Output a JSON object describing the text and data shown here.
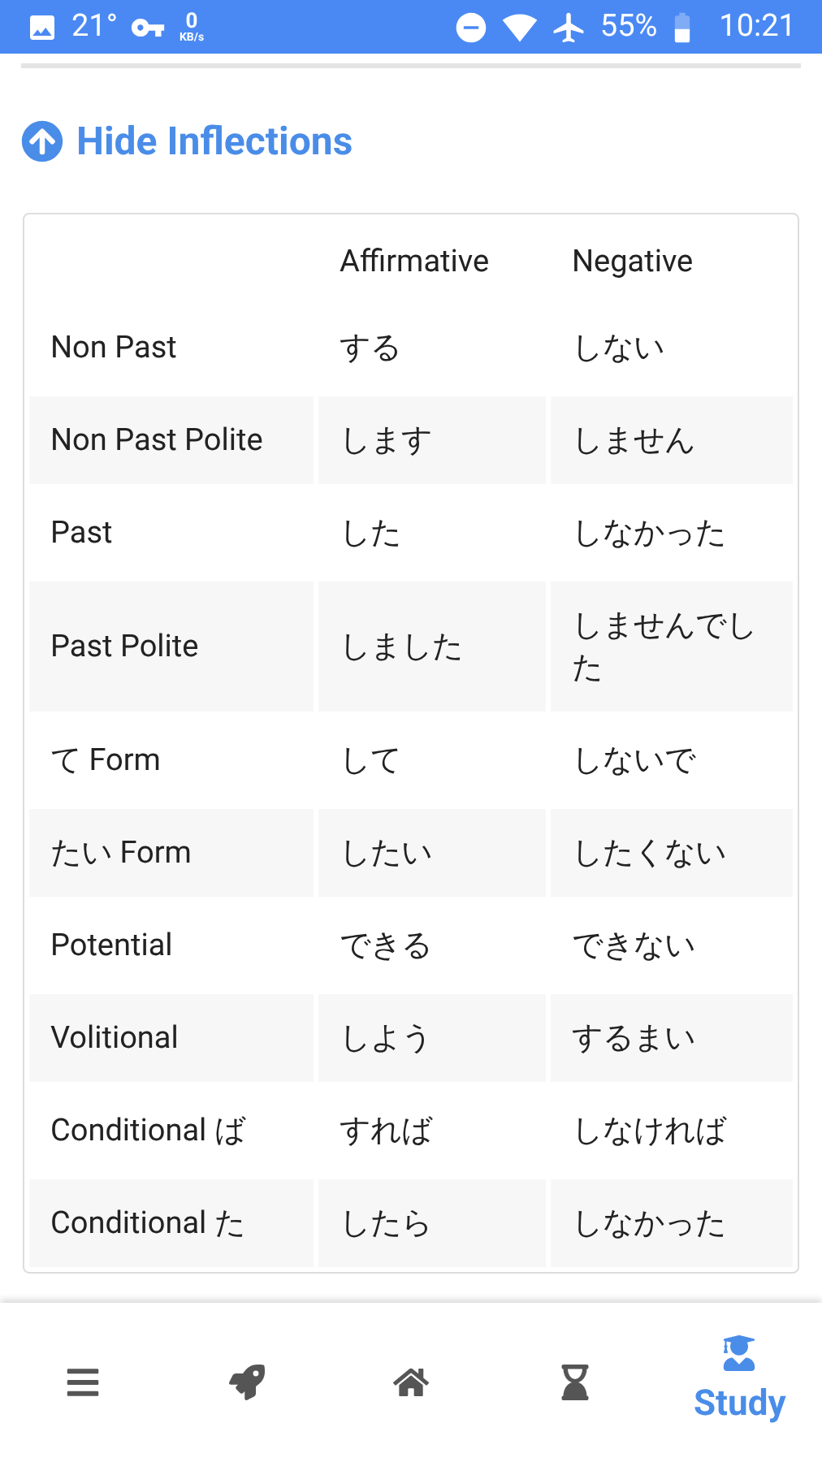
{
  "status_bar": {
    "temperature": "21°",
    "speed_value": "0",
    "speed_unit": "KB/s",
    "battery": "55%",
    "time": "10:21"
  },
  "toggle": {
    "label": "Hide Inflections",
    "expanded": true
  },
  "table": {
    "columns": [
      "Affirmative",
      "Negative"
    ],
    "rows": [
      {
        "form": "Non Past",
        "affirmative": "する",
        "negative": "しない"
      },
      {
        "form": "Non Past Polite",
        "affirmative": "します",
        "negative": "しません"
      },
      {
        "form": "Past",
        "affirmative": "した",
        "negative": "しなかった"
      },
      {
        "form": "Past Polite",
        "affirmative": "しました",
        "negative": "しませんでした"
      },
      {
        "form": "て Form",
        "affirmative": "して",
        "negative": "しないで"
      },
      {
        "form": "たい Form",
        "affirmative": "したい",
        "negative": "したくない"
      },
      {
        "form": "Potential",
        "affirmative": "できる",
        "negative": "できない"
      },
      {
        "form": "Volitional",
        "affirmative": "しよう",
        "negative": "するまい"
      },
      {
        "form": "Conditional ば",
        "affirmative": "すれば",
        "negative": "しなければ"
      },
      {
        "form": "Conditional た",
        "affirmative": "したら",
        "negative": "しなかった"
      }
    ]
  },
  "nav": [
    {
      "selected": false
    },
    {
      "selected": false
    },
    {
      "selected": false
    },
    {
      "selected": false
    },
    {
      "label": "Study",
      "selected": true
    }
  ]
}
